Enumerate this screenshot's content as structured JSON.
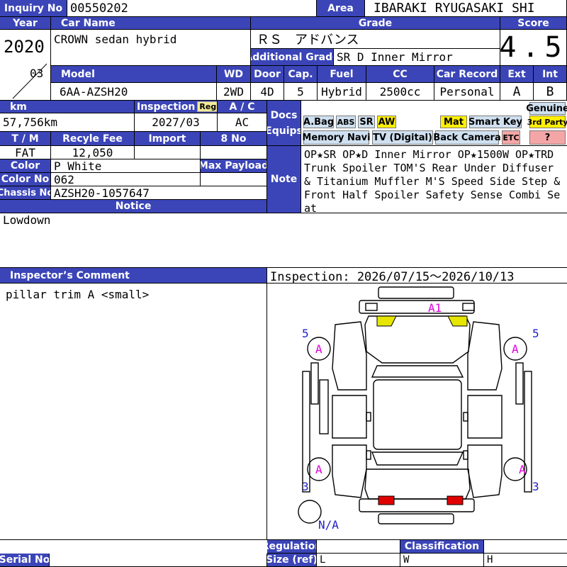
{
  "labels": {
    "inquiry_no": "Inquiry No",
    "area": "Area",
    "year": "Year",
    "car_name": "Car Name",
    "grade": "Grade",
    "score": "Score",
    "additional_grade": "Additional Grade",
    "model": "Model",
    "wd": "WD",
    "door": "Door",
    "cap": "Cap.",
    "fuel": "Fuel",
    "cc": "CC",
    "car_record": "Car Record",
    "ext": "Ext",
    "int": "Int",
    "km": "km",
    "inspection": "Inspection",
    "regist": "Regist",
    "ac": "A / C",
    "docs": "Docs",
    "equips": "Equips",
    "tm": "T / M",
    "recycle_fee": "Recyle Fee",
    "import": "Import",
    "eight_no": "8 No",
    "color": "Color",
    "max_payload": "Max Payload",
    "color_no": "Color No",
    "note": "Note",
    "chassis_no": "Chassis No",
    "notice": "Notice",
    "inspectors_comment": "Inspector’s Comment",
    "regulation": "Regulation",
    "classification": "Classification",
    "size_ref": "Size (ref)",
    "serial_no": "Serial No"
  },
  "values": {
    "inquiry_no": "00550202",
    "area": "IBARAKI RYUGASAKI SHI",
    "year": "2020",
    "month": "03",
    "car_name": "CROWN sedan hybrid",
    "grade": "ＲＳ　アドバンス",
    "score": "4.5",
    "additional_grade": "SR D Inner Mirror",
    "model": "6AA-AZSH20",
    "wd": "2WD",
    "door": "4D",
    "cap": "5",
    "fuel": "Hybrid",
    "cc": "2500cc",
    "car_record": "Personal",
    "ext": "A",
    "int": "B",
    "km": "57,756km",
    "inspection": "2027/03",
    "ac": "AC",
    "tm": "FAT",
    "recycle_fee": "12,050",
    "color": "P White",
    "color_no": "062",
    "chassis_no": "AZSH20-1057647",
    "note": "OP★SR OP★D Inner Mirror OP★1500W OP★TRD Trunk Spoiler TOM'S Rear Under Diffuser & Titanium Muffler M'S Speed Side Step & Front Half Spoiler Safety Sense Combi Seat",
    "notice": "Lowdown",
    "comment": "pillar trim A <small>",
    "inspection_period": "Inspection: 2026/07/15～2026/10/13",
    "size_l": "L",
    "size_w": "W",
    "size_h": "H"
  },
  "equips": {
    "abag": "A.Bag",
    "abs": "ABS",
    "sr": "SR",
    "aw": "AW",
    "mat": "Mat",
    "smart_key": "Smart Key",
    "genuine": "Genuine",
    "third_party": "3rd Party",
    "memory_navi": "Memory Navi",
    "tv": "TV (Digital)",
    "back_camera": "Back Camera",
    "etc": "ETC",
    "unknown": "?"
  },
  "diagram": {
    "a1": "A1",
    "a_left_front": "A",
    "a_right_front": "A",
    "a_left_rear": "A",
    "a_right_rear": "A",
    "five_left": "5",
    "five_right": "5",
    "three_left": "3",
    "three_right": "3",
    "na": "N/A",
    "colors": {
      "blue": "#2020c8",
      "magenta": "#e000e0",
      "yellow": "#e6e600",
      "red": "#e00000"
    }
  }
}
